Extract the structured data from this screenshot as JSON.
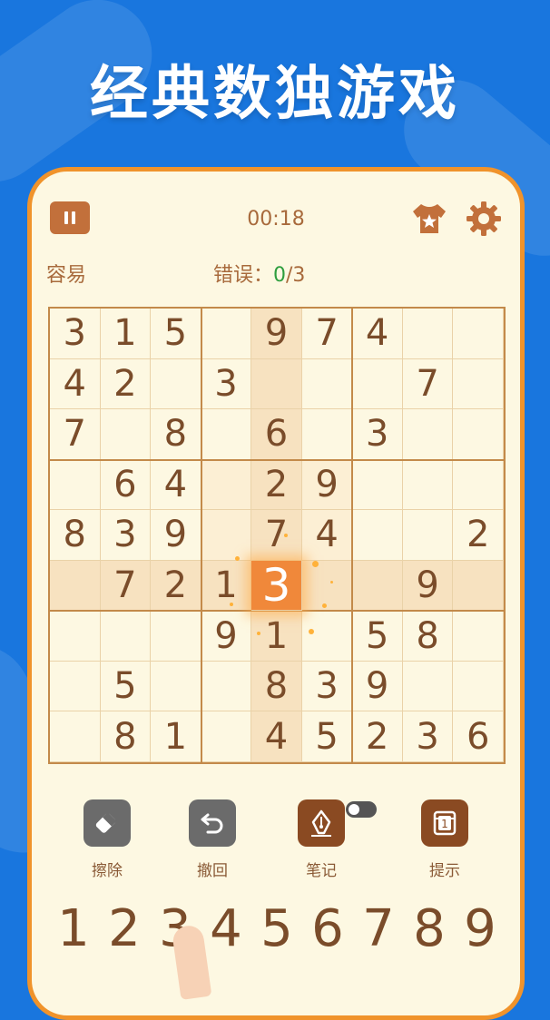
{
  "headline": "经典数独游戏",
  "game": {
    "timer": "00:18",
    "difficulty": "容易",
    "errors_label": "错误：",
    "errors_count": "0",
    "errors_max": "/3"
  },
  "grid": [
    [
      "3",
      "1",
      "5",
      "",
      "9",
      "7",
      "4",
      "",
      ""
    ],
    [
      "4",
      "2",
      "",
      "3",
      "",
      "",
      "",
      "7",
      ""
    ],
    [
      "7",
      "",
      "8",
      "",
      "6",
      "",
      "3",
      "",
      ""
    ],
    [
      "",
      "6",
      "4",
      "",
      "2",
      "9",
      "",
      "",
      ""
    ],
    [
      "8",
      "3",
      "9",
      "",
      "7",
      "4",
      "",
      "",
      "2"
    ],
    [
      "",
      "7",
      "2",
      "1",
      "3",
      "",
      "",
      "9",
      ""
    ],
    [
      "",
      "",
      "",
      "9",
      "1",
      "",
      "5",
      "8",
      ""
    ],
    [
      "",
      "5",
      "",
      "",
      "8",
      "3",
      "9",
      "",
      ""
    ],
    [
      "",
      "8",
      "1",
      "",
      "4",
      "5",
      "2",
      "3",
      "6"
    ]
  ],
  "selected_cell": {
    "row": 5,
    "col": 4
  },
  "tools": [
    {
      "label": "擦除",
      "icon": "eraser-icon",
      "color": "#6b6b6b"
    },
    {
      "label": "撤回",
      "icon": "undo-icon",
      "color": "#6b6b6b"
    },
    {
      "label": "笔记",
      "icon": "pen-icon",
      "color": "#8a4a22"
    },
    {
      "label": "提示",
      "icon": "hint-icon",
      "color": "#8a4a22"
    }
  ],
  "numpad": [
    "1",
    "2",
    "3",
    "4",
    "5",
    "6",
    "7",
    "8",
    "9"
  ],
  "colors": {
    "background": "#1976de",
    "board_bg": "#fdf8e2",
    "accent": "#f0932b",
    "selected": "#f0883a",
    "digit": "#7a4c2a",
    "error_count": "#2e9e3e"
  }
}
